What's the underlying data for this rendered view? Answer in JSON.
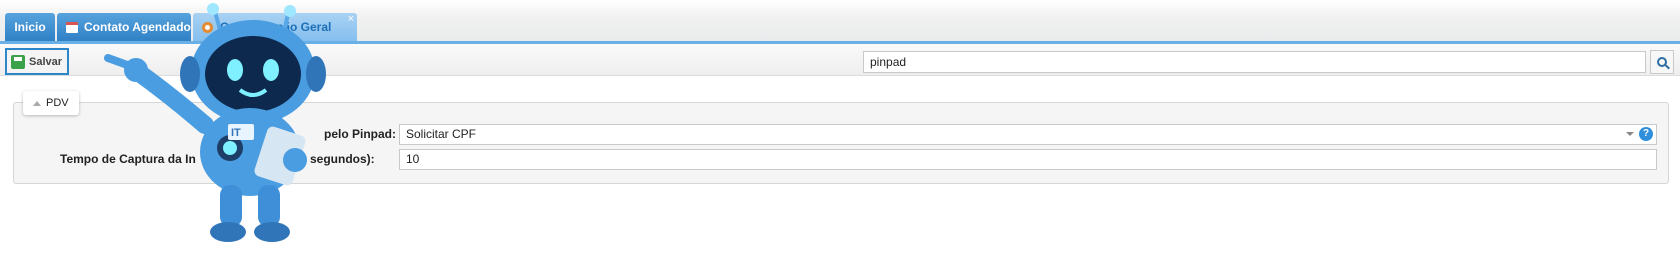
{
  "tabs": [
    {
      "label": "Inicio",
      "icon": ""
    },
    {
      "label": "Contato Agendado",
      "icon": "calendar-icon"
    },
    {
      "label": "Configuração Geral",
      "icon": "settings-icon",
      "active": true,
      "close": "×"
    }
  ],
  "toolbar": {
    "save_label": "Salvar",
    "search_value": "pinpad"
  },
  "section": {
    "legend": "PDV",
    "fields": [
      {
        "label": "pelo Pinpad:",
        "value": "Solicitar CPF",
        "help": "?"
      },
      {
        "label_left": "Tempo de Captura da In",
        "label_right": "segundos):",
        "value": "10"
      }
    ]
  },
  "mascot": {
    "badge_text": "IT"
  },
  "colors": {
    "tab_blue": "#2f80c6",
    "tab_active": "#85bfee",
    "accent": "#2e86c9",
    "robot_blue": "#3f8fd8"
  }
}
